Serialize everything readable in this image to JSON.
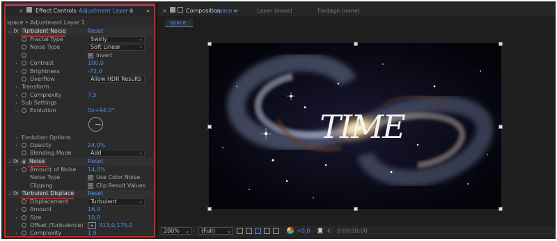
{
  "effect_controls": {
    "title": "Effect Controls",
    "layer": "Adjustment Layer 1",
    "breadcrumb": "space • Adjustment Layer 1",
    "effects": [
      {
        "name": "Turbulent Noise",
        "reset": "Reset"
      },
      {
        "name": "Noise",
        "reset": "Reset"
      },
      {
        "name": "Turbulent Displace",
        "reset": "Reset"
      }
    ],
    "properties": {
      "fractal_type": {
        "label": "Fractal Type",
        "value": "Swirly"
      },
      "noise_type": {
        "label": "Noise Type",
        "value": "Soft Linear"
      },
      "invert": {
        "label": "Invert"
      },
      "contrast": {
        "label": "Contrast",
        "value": "100,0"
      },
      "brightness": {
        "label": "Brightness",
        "value": "-72,0"
      },
      "overflow": {
        "label": "Overflow",
        "value": "Allow HDR Results"
      },
      "transform": {
        "label": "Transform"
      },
      "complexity": {
        "label": "Complexity",
        "value": "7,5"
      },
      "sub_settings": {
        "label": "Sub Settings"
      },
      "evolution": {
        "label": "Evolution",
        "value": "0x+94,0°"
      },
      "evolution_options": {
        "label": "Evolution Options"
      },
      "opacity": {
        "label": "Opacity",
        "value": "24,0%"
      },
      "blending_mode": {
        "label": "Blending Mode",
        "value": "Add"
      },
      "amount_of_noise": {
        "label": "Amount of Noise",
        "value": "14,0%"
      },
      "noise_type2": {
        "label": "Noise Type",
        "value": "Use Color Noise"
      },
      "clipping": {
        "label": "Clipping",
        "value": "Clip Result Values"
      },
      "displacement": {
        "label": "Displacement",
        "value": "Turbulent"
      },
      "amount": {
        "label": "Amount",
        "value": "16,0"
      },
      "size": {
        "label": "Size",
        "value": "10,0"
      },
      "offset": {
        "label": "Offset (Turbulence)",
        "value": "313,0,175,0"
      },
      "complexity2": {
        "label": "Complexity",
        "value": "1,9"
      }
    }
  },
  "composition": {
    "tab_label": "Composition",
    "comp_name": "space",
    "layer_tab": "Layer (none)",
    "footage_tab": "Footage (none)",
    "subtab": "space",
    "canvas_text": "TIME",
    "zoom": "200%",
    "resolution": "(Full)",
    "exposure": "+0,0",
    "timecode": "0:00:00:00"
  },
  "icons": {
    "close": "close-icon",
    "lock": "lock-icon",
    "menu": "menu-icon",
    "expand": "double-chevron-icon",
    "stopwatch": "stopwatch-icon",
    "camera": "camera-icon"
  },
  "colors": {
    "accent": "#4d91e6",
    "highlight": "#d91f1f"
  }
}
